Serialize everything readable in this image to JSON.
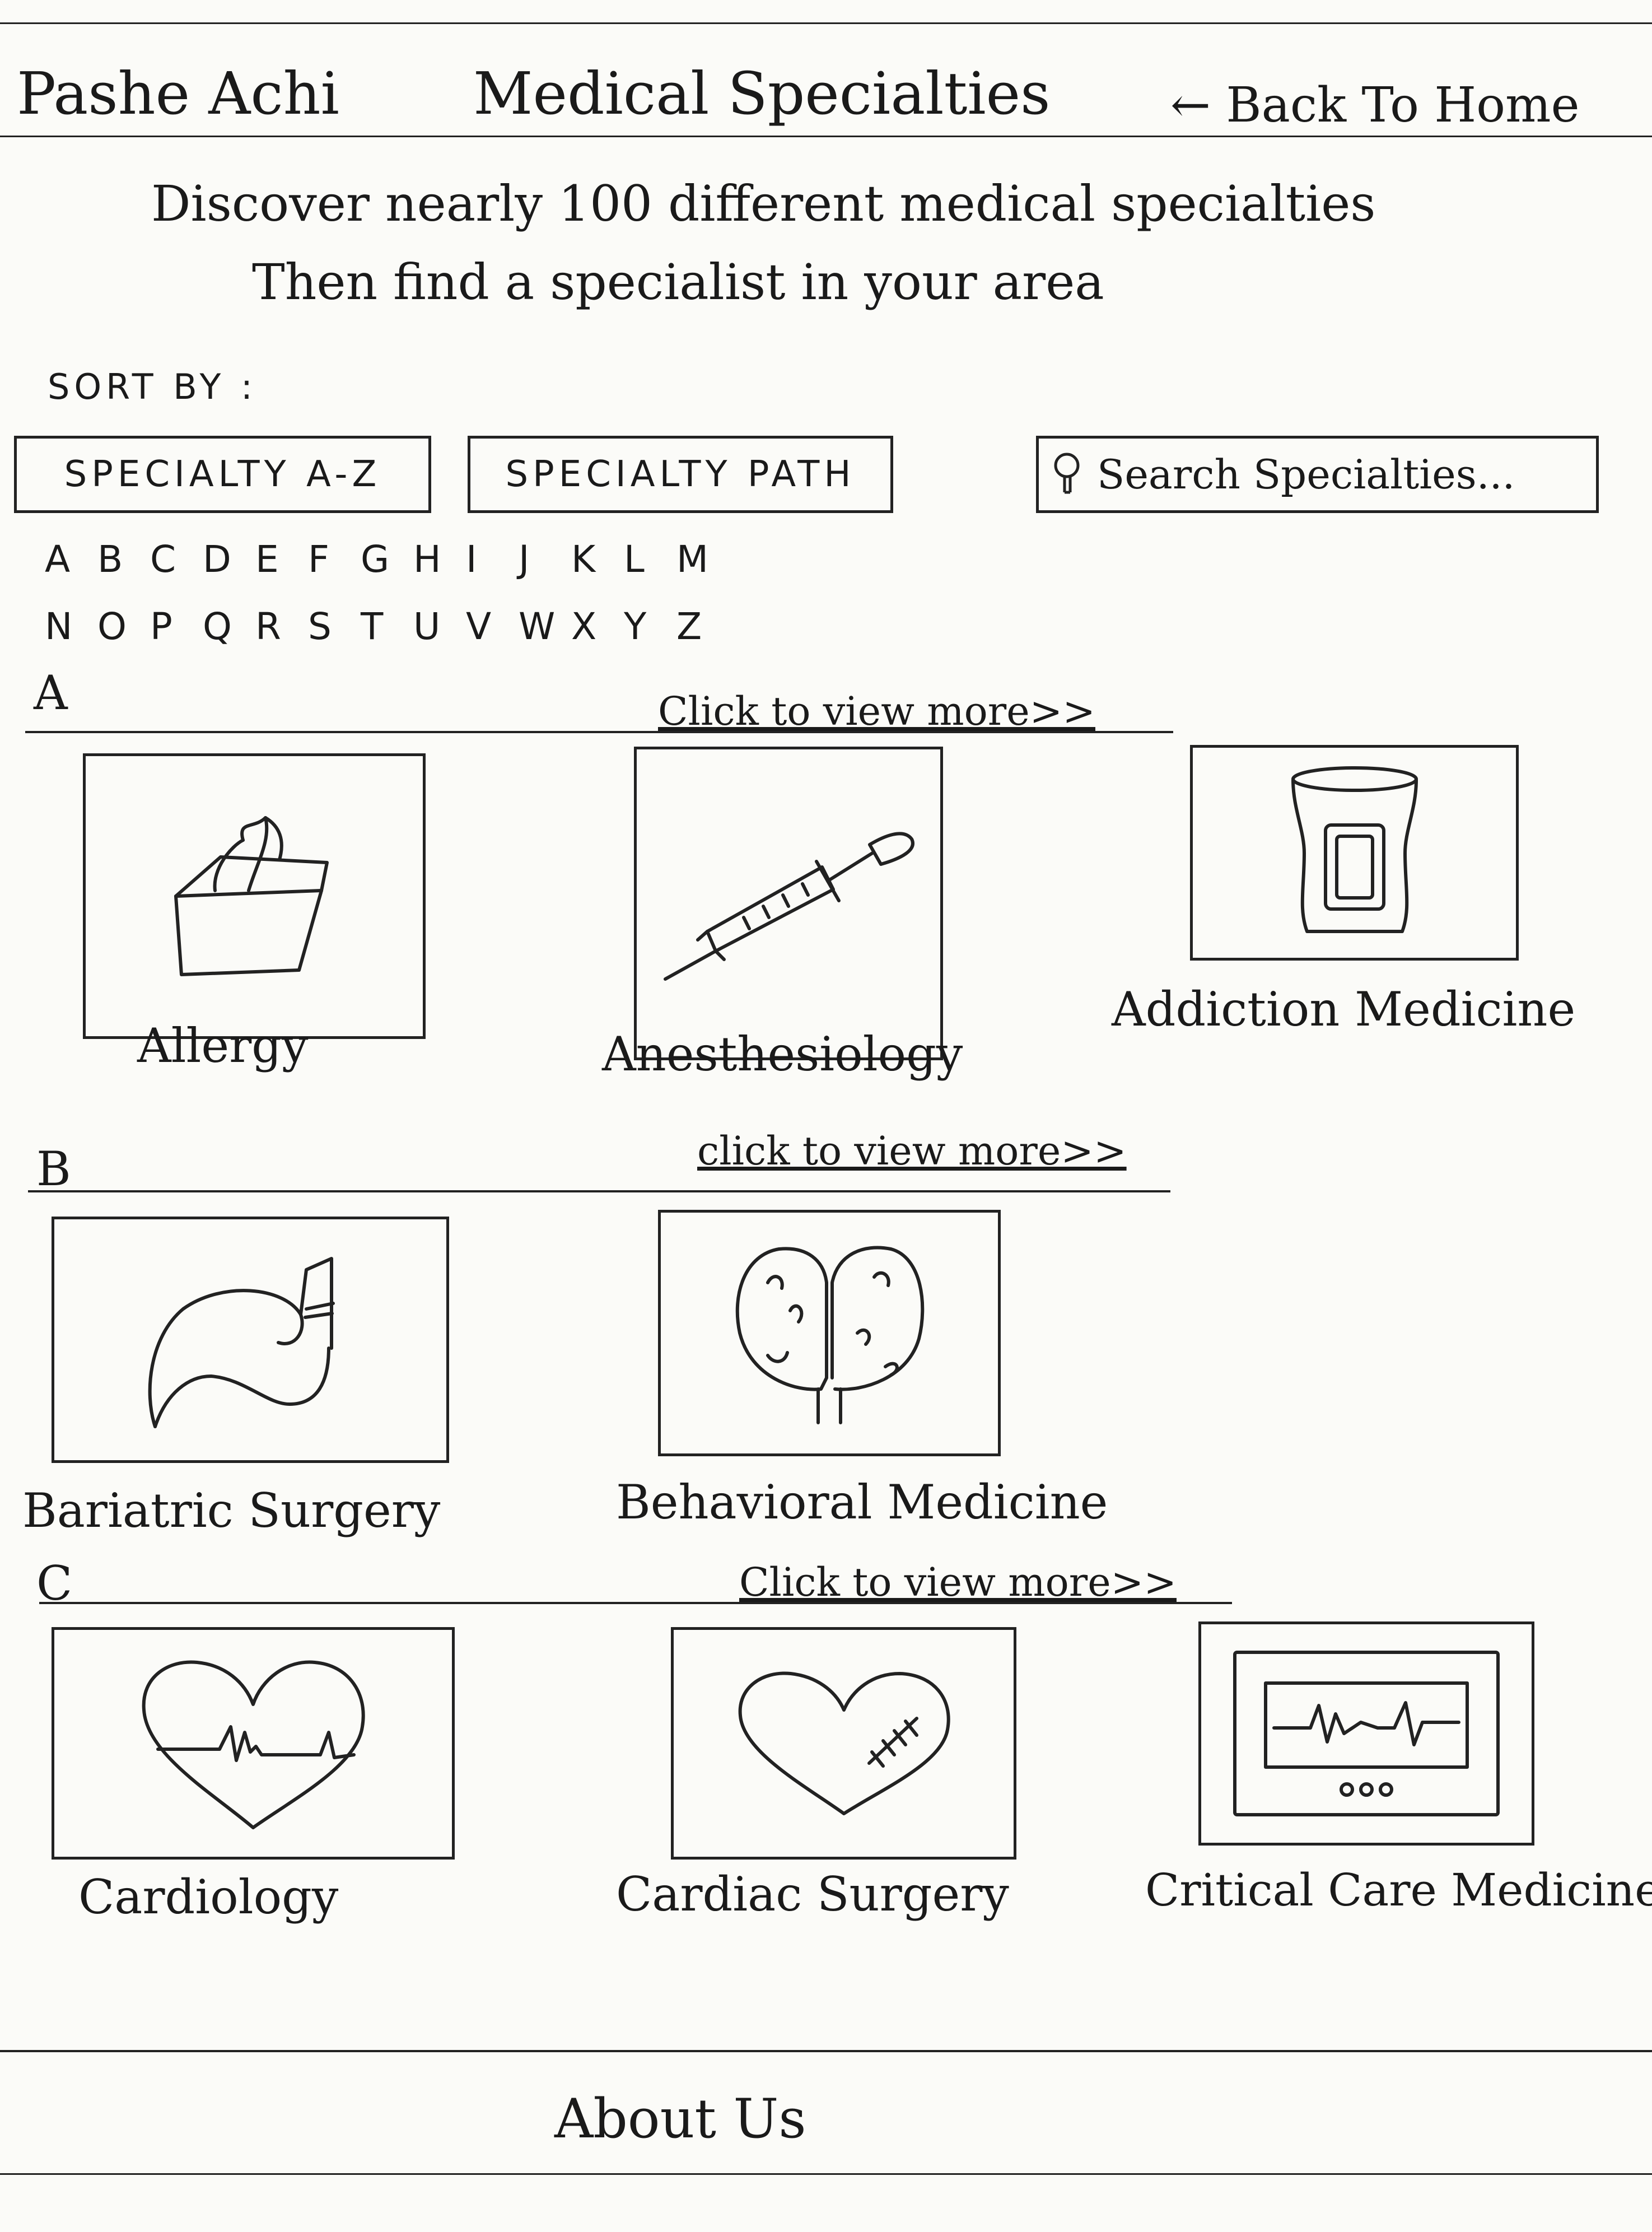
{
  "header": {
    "brand": "Pashe Achi",
    "title": "Medical Specialties",
    "back_link": "← Back To Home"
  },
  "intro": {
    "line1": "Discover nearly 100 different medical specialties",
    "line2": "Then find a specialist in your area"
  },
  "sort": {
    "label": "SORT BY :",
    "btn_az": "SPECIALTY A-Z",
    "btn_path": "SPECIALTY PATH",
    "search_placeholder": "Search Specialties..."
  },
  "alphabet": {
    "row1": [
      "A",
      "B",
      "C",
      "D",
      "E",
      "F",
      "G",
      "H",
      "I",
      "J",
      "K",
      "L",
      "M"
    ],
    "row2": [
      "N",
      "O",
      "P",
      "Q",
      "R",
      "S",
      "T",
      "U",
      "V",
      "W",
      "X",
      "Y",
      "Z"
    ]
  },
  "sections": [
    {
      "letter": "A",
      "more": "Click to view more>>",
      "items": [
        {
          "label": "Allergy",
          "icon": "tissue-box-icon"
        },
        {
          "label": "Anesthesiology",
          "icon": "syringe-icon"
        },
        {
          "label": "Addiction Medicine",
          "icon": "pill-jar-icon"
        }
      ]
    },
    {
      "letter": "B",
      "more": "click to view more>>",
      "items": [
        {
          "label": "Bariatric Surgery",
          "icon": "stomach-icon"
        },
        {
          "label": "Behavioral Medicine",
          "icon": "brain-icon"
        }
      ]
    },
    {
      "letter": "C",
      "more": "Click to view more>>",
      "items": [
        {
          "label": "Cardiology",
          "icon": "heart-pulse-icon"
        },
        {
          "label": "Cardiac Surgery",
          "icon": "heart-stitches-icon"
        },
        {
          "label": "Critical Care Medicine",
          "icon": "monitor-icon"
        }
      ]
    }
  ],
  "footer": {
    "about": "About Us"
  }
}
